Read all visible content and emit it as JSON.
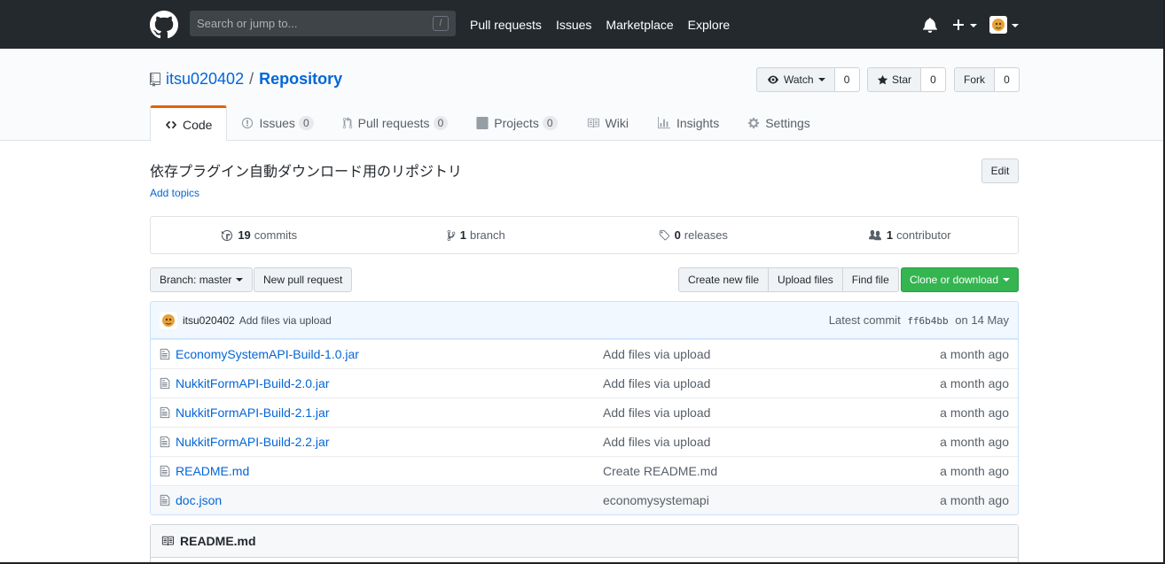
{
  "header": {
    "search_placeholder": "Search or jump to...",
    "search_shortcut": "/",
    "nav": [
      "Pull requests",
      "Issues",
      "Marketplace",
      "Explore"
    ],
    "plus": "+"
  },
  "repo": {
    "owner": "itsu020402",
    "separator": "/",
    "name": "Repository",
    "watch_label": "Watch",
    "watch_count": "0",
    "star_label": "Star",
    "star_count": "0",
    "fork_label": "Fork",
    "fork_count": "0"
  },
  "tabs": [
    {
      "label": "Code",
      "count": null,
      "selected": true
    },
    {
      "label": "Issues",
      "count": "0"
    },
    {
      "label": "Pull requests",
      "count": "0"
    },
    {
      "label": "Projects",
      "count": "0"
    },
    {
      "label": "Wiki",
      "count": null
    },
    {
      "label": "Insights",
      "count": null
    },
    {
      "label": "Settings",
      "count": null
    }
  ],
  "description": "依存プラグイン自動ダウンロード用のリポジトリ",
  "add_topics": "Add topics",
  "edit_label": "Edit",
  "summary": {
    "commits_num": "19",
    "commits_label": "commits",
    "branch_num": "1",
    "branch_label": "branch",
    "releases_num": "0",
    "releases_label": "releases",
    "contributor_num": "1",
    "contributor_label": "contributor"
  },
  "filenav": {
    "branch": "Branch: master",
    "new_pr": "New pull request",
    "create_file": "Create new file",
    "upload_files": "Upload files",
    "find_file": "Find file",
    "clone": "Clone or download"
  },
  "commit": {
    "author": "itsu020402",
    "message": "Add files via upload",
    "latest_label": "Latest commit",
    "sha": "ff6b4bb",
    "date": "on 14 May"
  },
  "files": [
    {
      "name": "EconomySystemAPI-Build-1.0.jar",
      "message": "Add files via upload",
      "age": "a month ago"
    },
    {
      "name": "NukkitFormAPI-Build-2.0.jar",
      "message": "Add files via upload",
      "age": "a month ago"
    },
    {
      "name": "NukkitFormAPI-Build-2.1.jar",
      "message": "Add files via upload",
      "age": "a month ago"
    },
    {
      "name": "NukkitFormAPI-Build-2.2.jar",
      "message": "Add files via upload",
      "age": "a month ago"
    },
    {
      "name": "README.md",
      "message": "Create README.md",
      "age": "a month ago"
    },
    {
      "name": "doc.json",
      "message": "economysystemapi",
      "age": "a month ago"
    }
  ],
  "readme_title": "README.md",
  "colors": {
    "header_bg": "#24292e",
    "link": "#0366d6",
    "clone_green": "#34b550",
    "tab_accent": "#e36209"
  }
}
